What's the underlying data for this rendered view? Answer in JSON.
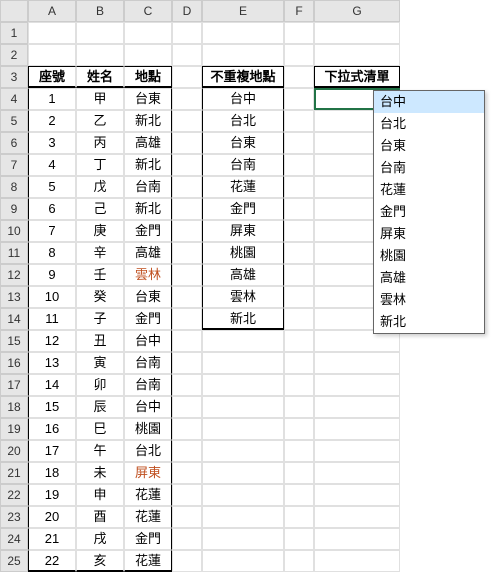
{
  "columns": [
    "A",
    "B",
    "C",
    "D",
    "E",
    "F",
    "G"
  ],
  "headers": {
    "seat": "座號",
    "name": "姓名",
    "place": "地點",
    "unique": "不重複地點",
    "dropdown": "下拉式清單"
  },
  "rows": [
    {
      "seat": "1",
      "name": "甲",
      "place": "台東"
    },
    {
      "seat": "2",
      "name": "乙",
      "place": "新北"
    },
    {
      "seat": "3",
      "name": "丙",
      "place": "高雄"
    },
    {
      "seat": "4",
      "name": "丁",
      "place": "新北"
    },
    {
      "seat": "5",
      "name": "戊",
      "place": "台南"
    },
    {
      "seat": "6",
      "name": "己",
      "place": "新北"
    },
    {
      "seat": "7",
      "name": "庚",
      "place": "金門"
    },
    {
      "seat": "8",
      "name": "辛",
      "place": "高雄"
    },
    {
      "seat": "9",
      "name": "壬",
      "place": "雲林",
      "hl": true
    },
    {
      "seat": "10",
      "name": "癸",
      "place": "台東"
    },
    {
      "seat": "11",
      "name": "子",
      "place": "金門"
    },
    {
      "seat": "12",
      "name": "丑",
      "place": "台中"
    },
    {
      "seat": "13",
      "name": "寅",
      "place": "台南"
    },
    {
      "seat": "14",
      "name": "卯",
      "place": "台南"
    },
    {
      "seat": "15",
      "name": "辰",
      "place": "台中"
    },
    {
      "seat": "16",
      "name": "巳",
      "place": "桃園"
    },
    {
      "seat": "17",
      "name": "午",
      "place": "台北"
    },
    {
      "seat": "18",
      "name": "未",
      "place": "屏東",
      "hl": true
    },
    {
      "seat": "19",
      "name": "申",
      "place": "花蓮"
    },
    {
      "seat": "20",
      "name": "酉",
      "place": "花蓮"
    },
    {
      "seat": "21",
      "name": "戌",
      "place": "金門"
    },
    {
      "seat": "22",
      "name": "亥",
      "place": "花蓮"
    }
  ],
  "unique_places": [
    "台中",
    "台北",
    "台東",
    "台南",
    "花蓮",
    "金門",
    "屏東",
    "桃園",
    "高雄",
    "雲林",
    "新北"
  ],
  "dropdown_items": [
    "台中",
    "台北",
    "台東",
    "台南",
    "花蓮",
    "金門",
    "屏東",
    "桃園",
    "高雄",
    "雲林",
    "新北"
  ],
  "dropdown_selected_index": 0
}
